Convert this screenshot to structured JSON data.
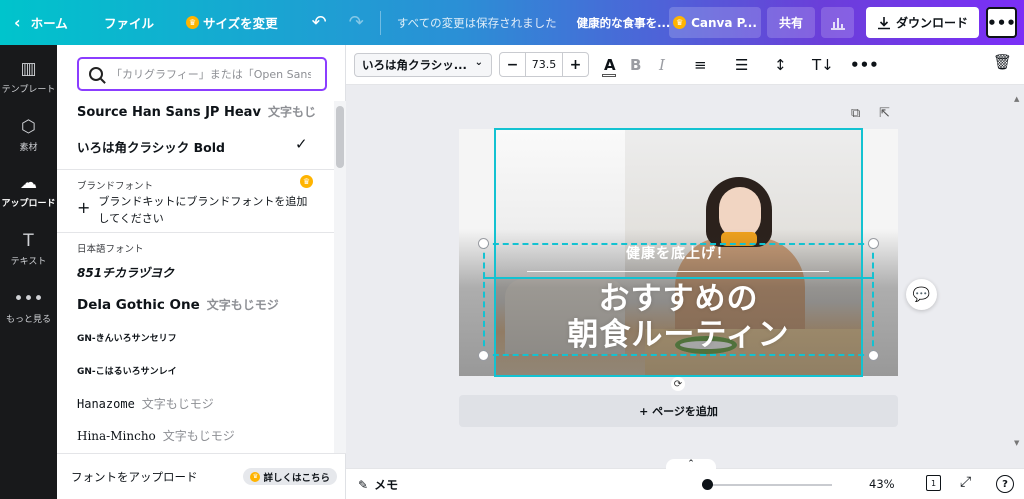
{
  "topbar": {
    "home": "ホーム",
    "file": "ファイル",
    "resize": "サイズを変更",
    "saved_status": "すべての変更は保存されました",
    "doc_title": "健康的な食事を...",
    "canva_pro": "Canva P...",
    "share": "共有",
    "download": "ダウンロード",
    "more": "•••"
  },
  "rail": {
    "items": [
      {
        "label": "テンプレート",
        "icon": "template-icon"
      },
      {
        "label": "素材",
        "icon": "elements-icon"
      },
      {
        "label": "アップロード",
        "icon": "upload-icon"
      },
      {
        "label": "テキスト",
        "icon": "text-icon"
      },
      {
        "label": "もっと見る",
        "icon": "more-icon"
      }
    ]
  },
  "panel": {
    "search_placeholder": "「カリグラフィー」または「Open Sans」",
    "fonts_top": [
      {
        "name": "Source Han Sans JP Heav",
        "sample": "文字もじモジ"
      },
      {
        "name": "いろは角クラシック Bold",
        "sample": ""
      }
    ],
    "brand_label": "ブランドフォント",
    "brand_add": "ブランドキットにブランドフォントを追加してください",
    "japanese_label": "日本語フォント",
    "fonts_jp": [
      {
        "name": "851チカラヅヨク",
        "sample": ""
      },
      {
        "name": "Dela Gothic One",
        "sample": "文字もじモジ"
      },
      {
        "name": "GN-きんいろサンセリフ",
        "sample": ""
      },
      {
        "name": "GN-こはるいろサンレイ",
        "sample": ""
      },
      {
        "name": "Hanazome",
        "sample": "文字もじモジ"
      },
      {
        "name": "Hina-Mincho",
        "sample": "文字もじモジ"
      }
    ],
    "upload_font": "フォントをアップロード",
    "more_link": "詳しくはこちら"
  },
  "toolbar": {
    "font_name": "いろは角クラシッ...",
    "font_size": "73.5"
  },
  "canvas": {
    "subtitle": "健康を底上げ！",
    "title_line1": "おすすめの",
    "title_line2": "朝食ルーティン",
    "add_page": "+ ページを追加"
  },
  "bottombar": {
    "notes": "メモ",
    "zoom": "43%",
    "page_count": "1"
  },
  "colors": {
    "accent": "#8b3dff",
    "selection": "#13c2d1",
    "crown": "#ffb400"
  }
}
